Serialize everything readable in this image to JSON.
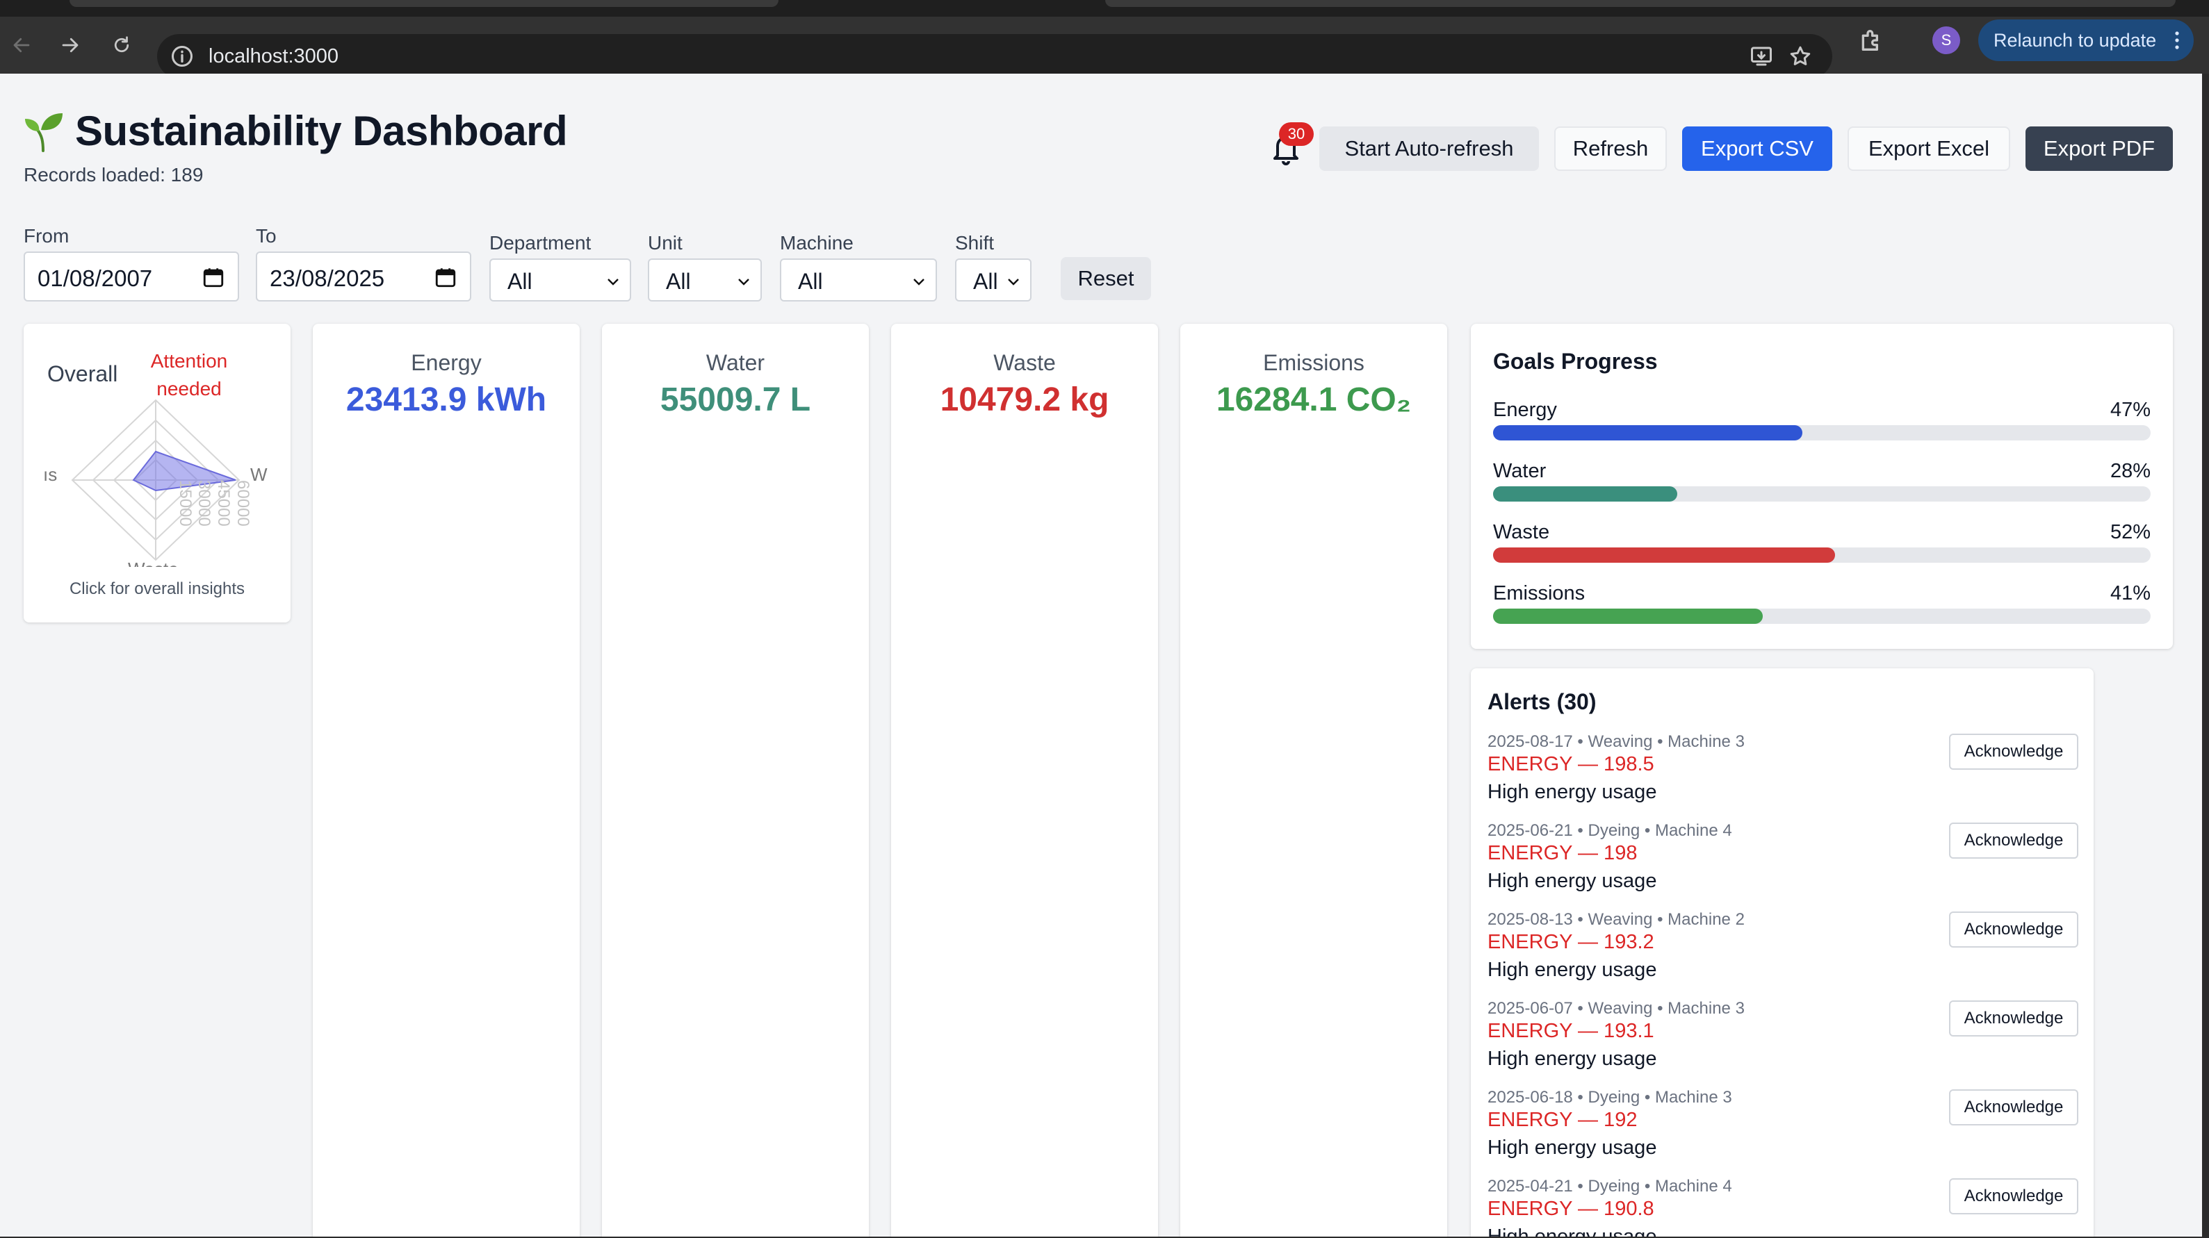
{
  "browser": {
    "url": "localhost:3000",
    "profile_initial": "S",
    "relaunch_label": "Relaunch to update"
  },
  "header": {
    "title": "Sustainability Dashboard",
    "records_loaded": "Records loaded: 189",
    "notification_count": "30",
    "buttons": {
      "auto_refresh": "Start Auto-refresh",
      "refresh": "Refresh",
      "export_csv": "Export CSV",
      "export_excel": "Export Excel",
      "export_pdf": "Export PDF"
    }
  },
  "filters": {
    "from_label": "From",
    "from_value": "01/08/2007",
    "to_label": "To",
    "to_value": "23/08/2025",
    "department_label": "Department",
    "department_value": "All",
    "unit_label": "Unit",
    "unit_value": "All",
    "machine_label": "Machine",
    "machine_value": "All",
    "shift_label": "Shift",
    "shift_value": "All",
    "reset_label": "Reset"
  },
  "overall": {
    "label": "Overall",
    "status": "Attention needed",
    "hint": "Click for overall insights",
    "radar_labels": {
      "left": "ıs",
      "right": "W",
      "bottom": "Waste"
    },
    "radar_ticks": [
      "15000",
      "30000",
      "45000",
      "60000"
    ]
  },
  "metrics": [
    {
      "label": "Energy",
      "value": "23413.9 kWh",
      "color": "#3b5bdb"
    },
    {
      "label": "Water",
      "value": "55009.7 L",
      "color": "#3f8f7a"
    },
    {
      "label": "Waste",
      "value": "10479.2 kg",
      "color": "#d03030"
    },
    {
      "label": "Emissions",
      "value": "16284.1 CO₂",
      "color": "#3d9a4e"
    }
  ],
  "goals": {
    "title": "Goals Progress",
    "items": [
      {
        "name": "Energy",
        "pct_label": "47%",
        "pct": 47,
        "color": "#2f55d4"
      },
      {
        "name": "Water",
        "pct_label": "28%",
        "pct": 28,
        "color": "#3a8f7d"
      },
      {
        "name": "Waste",
        "pct_label": "52%",
        "pct": 52,
        "color": "#d13b3b"
      },
      {
        "name": "Emissions",
        "pct_label": "41%",
        "pct": 41,
        "color": "#46a352"
      }
    ]
  },
  "alerts": {
    "title": "Alerts (30)",
    "ack_label": "Acknowledge",
    "items": [
      {
        "meta": "2025-08-17 • Weaving • Machine 3",
        "value": "ENERGY — 198.5",
        "message": "High energy usage"
      },
      {
        "meta": "2025-06-21 • Dyeing • Machine 4",
        "value": "ENERGY — 198",
        "message": "High energy usage"
      },
      {
        "meta": "2025-08-13 • Weaving • Machine 2",
        "value": "ENERGY — 193.2",
        "message": "High energy usage"
      },
      {
        "meta": "2025-06-07 • Weaving • Machine 3",
        "value": "ENERGY — 193.1",
        "message": "High energy usage"
      },
      {
        "meta": "2025-06-18 • Dyeing • Machine 3",
        "value": "ENERGY — 192",
        "message": "High energy usage"
      },
      {
        "meta": "2025-04-21 • Dyeing • Machine 4",
        "value": "ENERGY — 190.8",
        "message": "High energy usage"
      }
    ]
  }
}
